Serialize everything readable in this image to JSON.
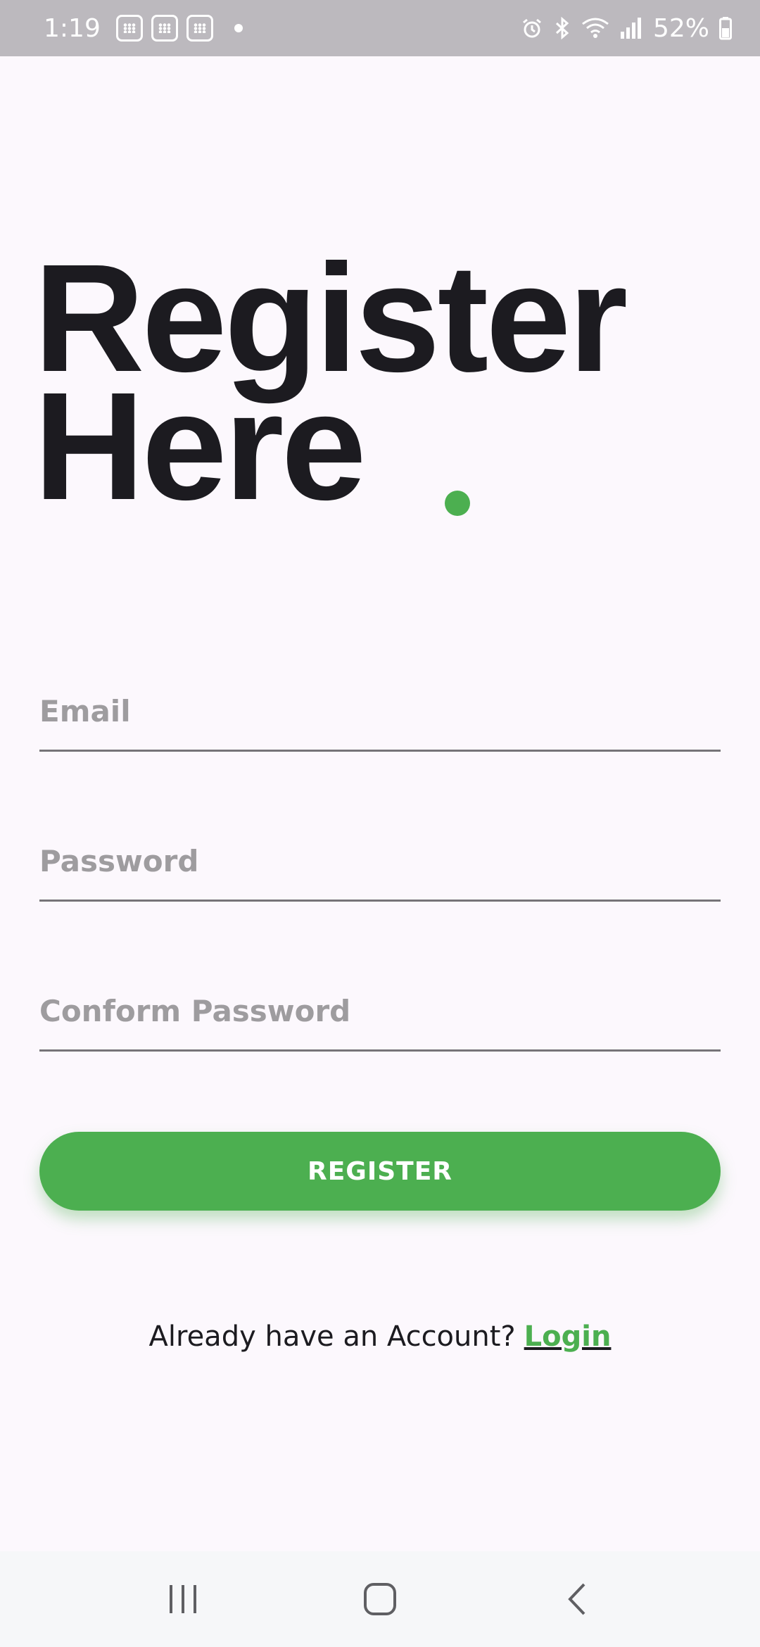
{
  "status_bar": {
    "time": "1:19",
    "battery_percent": "52%",
    "notification_icons": [
      "app-grid-icon",
      "app-grid-icon",
      "app-grid-icon"
    ],
    "system_icons": [
      "alarm-icon",
      "bluetooth-icon",
      "wifi-icon",
      "signal-icon",
      "battery-icon"
    ]
  },
  "title": {
    "line1": "Register",
    "line2": "Here"
  },
  "form": {
    "email_placeholder": "Email",
    "email_value": "",
    "password_placeholder": "Password",
    "password_value": "",
    "confirm_placeholder": "Conform Password",
    "confirm_value": ""
  },
  "register_button": "REGISTER",
  "login_prompt": {
    "text": "Already have an Account?",
    "link": "Login"
  },
  "navigation": {
    "buttons": [
      "recent-apps-icon",
      "home-icon",
      "back-icon"
    ]
  },
  "colors": {
    "accent": "#4caf50",
    "background": "#fcf8fd",
    "title_text": "#1c1b20",
    "placeholder": "#9e9c9f",
    "status_bar": "#bcb9be"
  }
}
